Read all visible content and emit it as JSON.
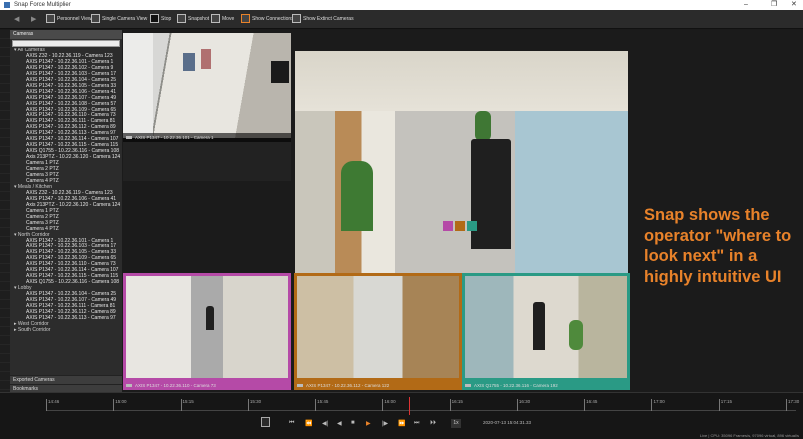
{
  "window": {
    "title": "Snap Force Multiplier",
    "controls": [
      "–",
      "❐",
      "✕"
    ]
  },
  "toolbar": {
    "items": [
      {
        "label": "Personnel View"
      },
      {
        "label": "Single Camera View"
      },
      {
        "label": "Stop"
      },
      {
        "label": "Snapshot"
      },
      {
        "label": "Move"
      },
      {
        "label": "Show Connections"
      },
      {
        "label": "Show Extinct Cameras"
      }
    ]
  },
  "sidebar": {
    "header": "Cameras",
    "tree": [
      {
        "t": "g",
        "label": "▾ All Cameras"
      },
      {
        "t": "c",
        "label": "AXIS Z32 - 10.22.36.119 - Camera 123"
      },
      {
        "t": "c",
        "label": "AXIS P1347 - 10.22.36.101 - Camera 1"
      },
      {
        "t": "c",
        "label": "AXIS P1347 - 10.22.36.102 - Camera 9"
      },
      {
        "t": "c",
        "label": "AXIS P1347 - 10.22.36.103 - Camera 17"
      },
      {
        "t": "c",
        "label": "AXIS P1347 - 10.22.36.104 - Camera 25"
      },
      {
        "t": "c",
        "label": "AXIS P1347 - 10.22.36.105 - Camera 33"
      },
      {
        "t": "c",
        "label": "AXIS P1347 - 10.22.36.106 - Camera 41"
      },
      {
        "t": "c",
        "label": "AXIS P1347 - 10.22.36.107 - Camera 49"
      },
      {
        "t": "c",
        "label": "AXIS P1347 - 10.22.36.108 - Camera 57"
      },
      {
        "t": "c",
        "label": "AXIS P1347 - 10.22.36.109 - Camera 65"
      },
      {
        "t": "c",
        "label": "AXIS P1347 - 10.22.36.110 - Camera 73"
      },
      {
        "t": "c",
        "label": "AXIS P1347 - 10.22.36.111 - Camera 81"
      },
      {
        "t": "c",
        "label": "AXIS P1347 - 10.22.36.112 - Camera 89"
      },
      {
        "t": "c",
        "label": "AXIS P1347 - 10.22.36.113 - Camera 97"
      },
      {
        "t": "c",
        "label": "AXIS P1347 - 10.22.36.114 - Camera 107"
      },
      {
        "t": "c",
        "label": "AXIS P1347 - 10.22.36.115 - Camera 115"
      },
      {
        "t": "c",
        "label": "AXIS Q1755 - 10.22.36.116 - Camera 108"
      },
      {
        "t": "c",
        "label": "Axis 213PTZ - 10.22.36.120 - Camera 124"
      },
      {
        "t": "c",
        "label": "Camera 1 PTZ"
      },
      {
        "t": "c",
        "label": "Camera 2 PTZ"
      },
      {
        "t": "c",
        "label": "Camera 3 PTZ"
      },
      {
        "t": "c",
        "label": "Camera 4 PTZ"
      },
      {
        "t": "g",
        "label": "▾ Meals / Kitchen"
      },
      {
        "t": "c",
        "label": "AXIS Z32 - 10.22.36.119 - Camera 123"
      },
      {
        "t": "c",
        "label": "AXIS P1347 - 10.22.36.106 - Camera 41"
      },
      {
        "t": "c",
        "label": "Axis 213PTZ - 10.22.36.120 - Camera 124"
      },
      {
        "t": "c",
        "label": "Camera 1 PTZ"
      },
      {
        "t": "c",
        "label": "Camera 2 PTZ"
      },
      {
        "t": "c",
        "label": "Camera 3 PTZ"
      },
      {
        "t": "c",
        "label": "Camera 4 PTZ"
      },
      {
        "t": "g",
        "label": "▾ North Corridor"
      },
      {
        "t": "c",
        "label": "AXIS P1347 - 10.22.36.101 - Camera 1"
      },
      {
        "t": "c",
        "label": "AXIS P1347 - 10.22.36.103 - Camera 17"
      },
      {
        "t": "c",
        "label": "AXIS P1347 - 10.22.36.105 - Camera 33"
      },
      {
        "t": "c",
        "label": "AXIS P1347 - 10.22.36.109 - Camera 65"
      },
      {
        "t": "c",
        "label": "AXIS P1347 - 10.22.36.110 - Camera 73"
      },
      {
        "t": "c",
        "label": "AXIS P1347 - 10.22.36.114 - Camera 107"
      },
      {
        "t": "c",
        "label": "AXIS P1347 - 10.22.36.115 - Camera 115"
      },
      {
        "t": "c",
        "label": "AXIS Q1755 - 10.22.36.116 - Camera 108"
      },
      {
        "t": "g",
        "label": "▾ Lobby"
      },
      {
        "t": "c",
        "label": "AXIS P1347 - 10.22.36.104 - Camera 25"
      },
      {
        "t": "c",
        "label": "AXIS P1347 - 10.22.36.107 - Camera 49"
      },
      {
        "t": "c",
        "label": "AXIS P1347 - 10.22.36.111 - Camera 81"
      },
      {
        "t": "c",
        "label": "AXIS P1347 - 10.22.36.112 - Camera 89"
      },
      {
        "t": "c",
        "label": "AXIS P1347 - 10.22.36.113 - Camera 97"
      },
      {
        "t": "g",
        "label": "▸ West Corridor"
      },
      {
        "t": "g",
        "label": "▸ South Corridor"
      }
    ],
    "sections": [
      "Exported Cameras",
      "Bookmarks"
    ]
  },
  "tiles": [
    {
      "caption": "AXIS P1347 - 10.22.36.101 - Camera 1"
    },
    {
      "caption": "AXIS P1347 - 10.22.36.106 - Camera 41"
    },
    {
      "caption": "AXIS P1347 - 10.22.36.110 - Camera 73"
    },
    {
      "caption": "AXIS P1347 - 10.22.36.112 - Camera 122"
    },
    {
      "caption": "AXIS Q1755 - 10.22.36.116 - Camera 192"
    }
  ],
  "callout": "Snap shows the operator \"where to look next\" in a highly intuitive UI",
  "timeline": {
    "ticks": [
      "14:46",
      "15:00",
      "15:15",
      "15:30",
      "15:45",
      "16:00",
      "16:15",
      "16:30",
      "16:45",
      "17:00",
      "17:15",
      "17:30"
    ],
    "speed": "1x",
    "timestamp": "2020-07-13 15:04:31.33",
    "status": "Live | CPU: 35096 Frames/s, 97096 virtual, 896 virtual/s"
  },
  "colors": {
    "magenta": "#b54aa7",
    "orange": "#b26a16",
    "teal": "#2a9a85",
    "callout": "#e8822a"
  }
}
